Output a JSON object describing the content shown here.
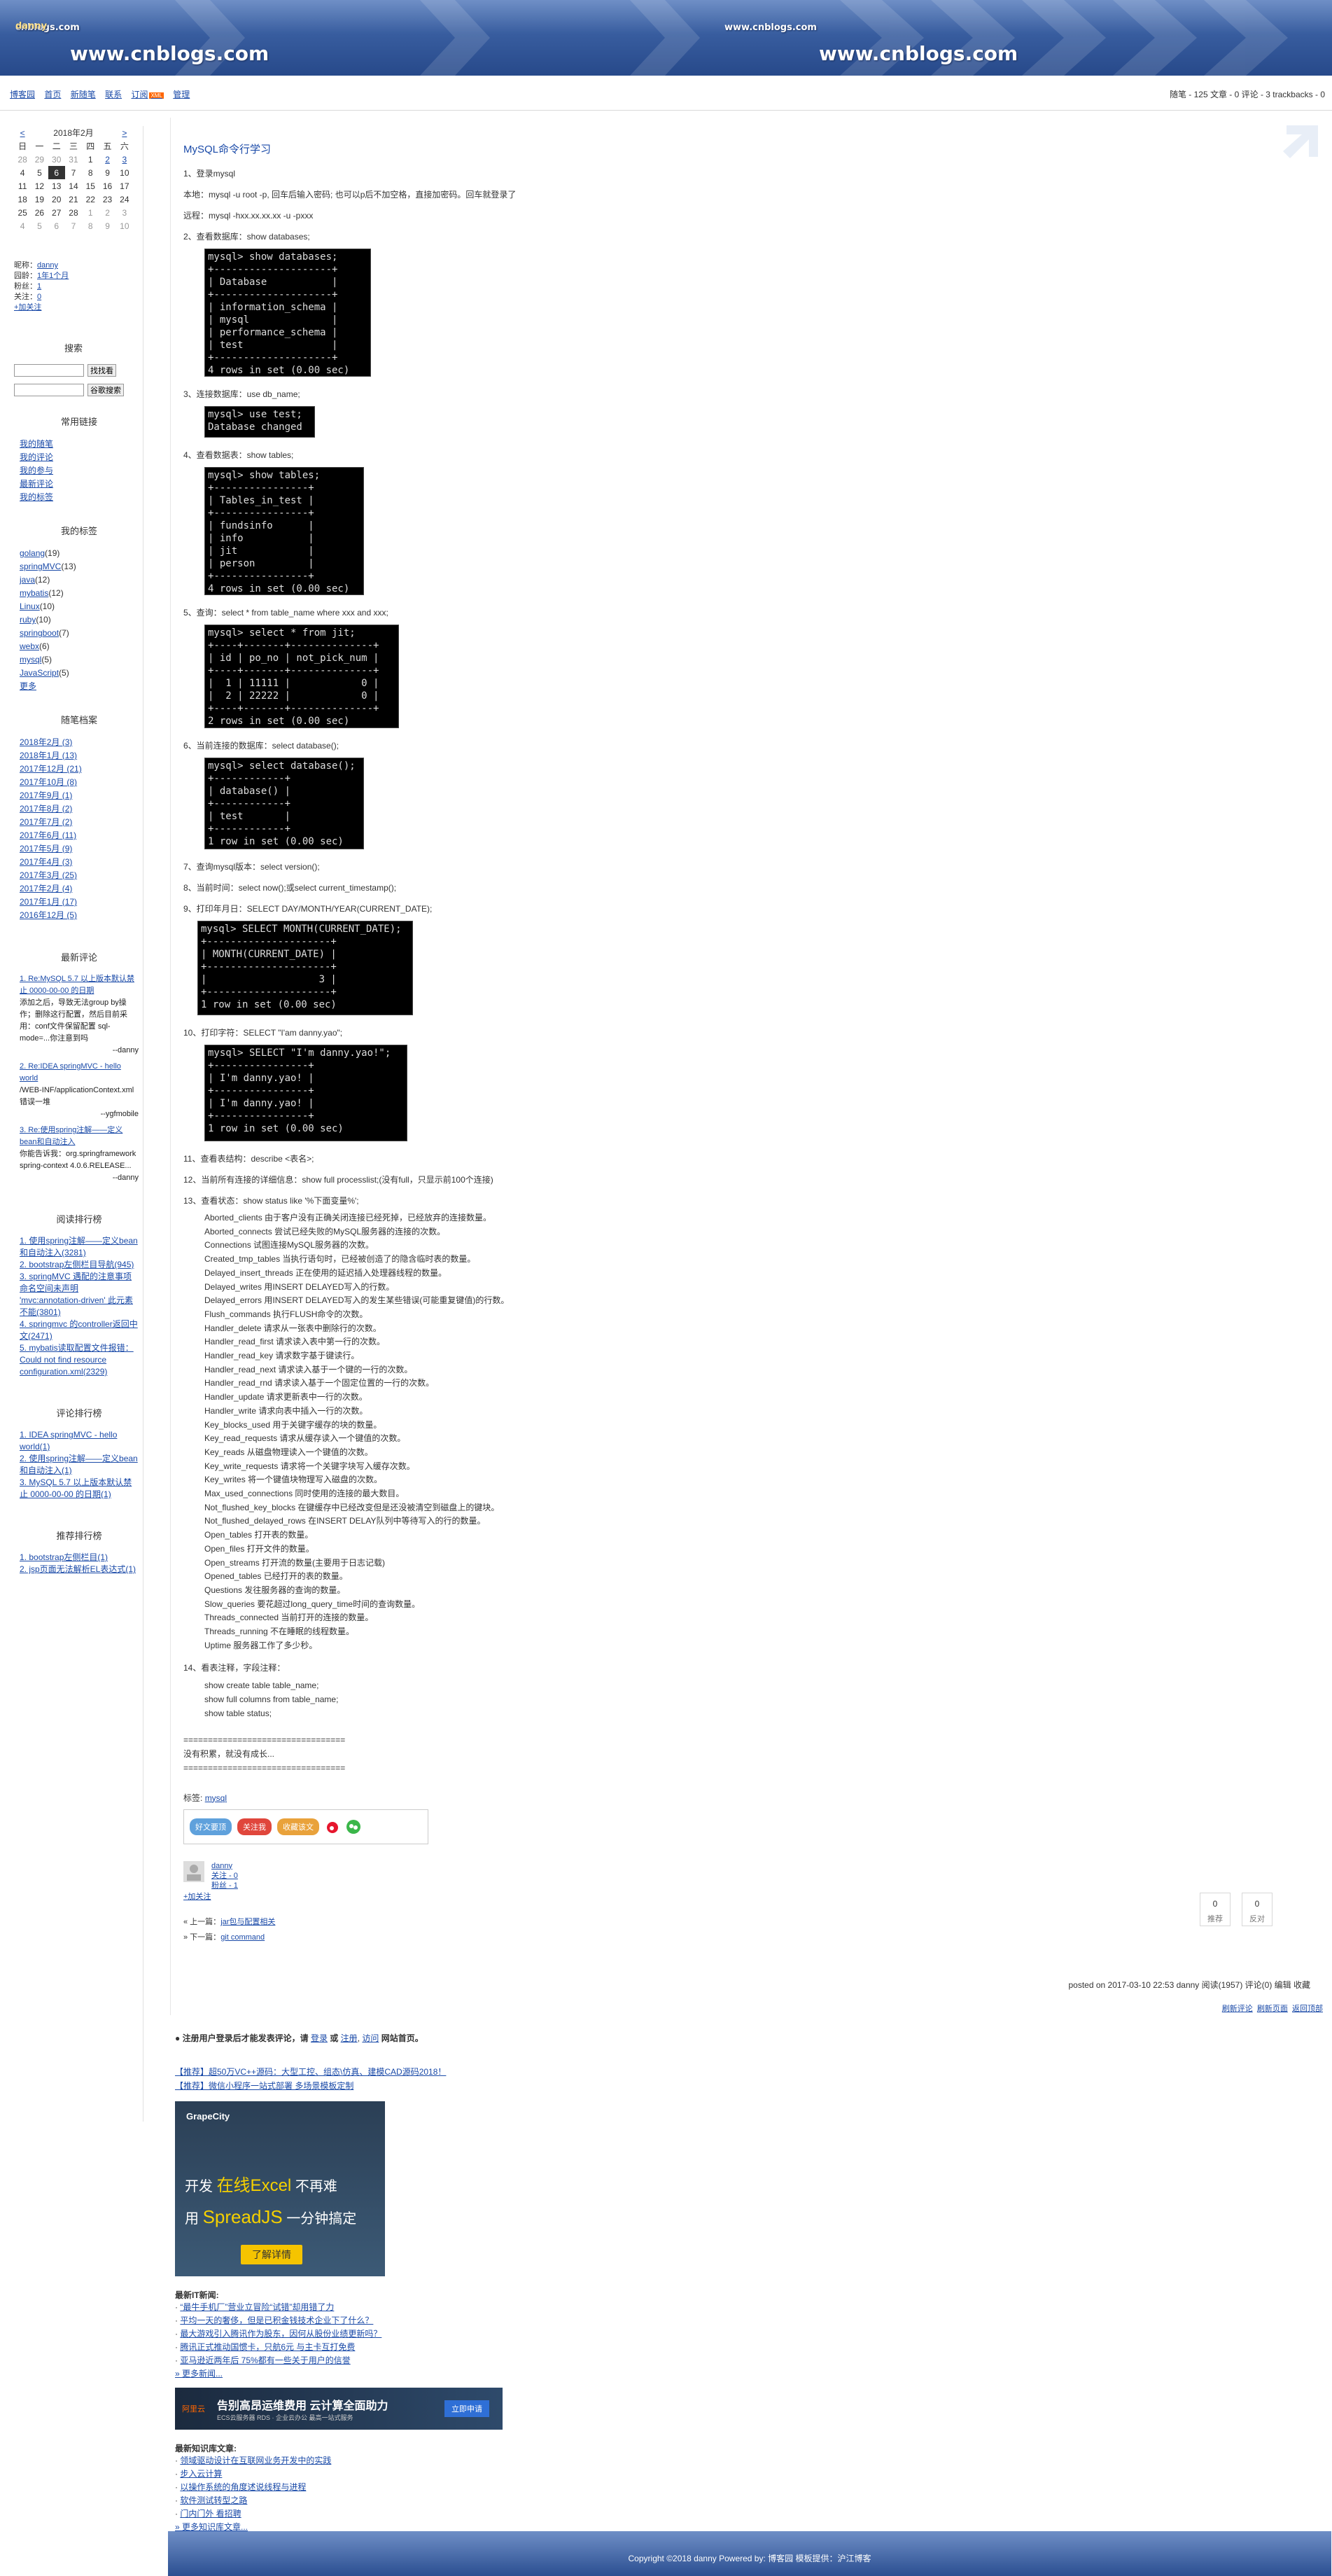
{
  "header": {
    "site_left_top": "cnblogs.com",
    "site_left_big": "www.cnblogs.com",
    "site_right_top": "www.cnblogs.com",
    "site_right_big": "www.cnblogs.com",
    "blog_name": "danny"
  },
  "nav": {
    "links": [
      "博客园",
      "首页",
      "新随笔",
      "联系",
      "订阅",
      "管理"
    ],
    "rss_badge": "XML",
    "stats": "随笔 - 125  文章 - 0  评论 - 3  trackbacks - 0"
  },
  "calendar": {
    "prev": "<",
    "title": "2018年2月",
    "next": ">",
    "weekdays": [
      "日",
      "一",
      "二",
      "三",
      "四",
      "五",
      "六"
    ],
    "rows": [
      [
        "28",
        "29",
        "30",
        "31",
        "1",
        "2",
        "3"
      ],
      [
        "4",
        "5",
        "6",
        "7",
        "8",
        "9",
        "10"
      ],
      [
        "11",
        "12",
        "13",
        "14",
        "15",
        "16",
        "17"
      ],
      [
        "18",
        "19",
        "20",
        "21",
        "22",
        "23",
        "24"
      ],
      [
        "25",
        "26",
        "27",
        "28",
        "1",
        "2",
        "3"
      ],
      [
        "4",
        "5",
        "6",
        "7",
        "8",
        "9",
        "10"
      ]
    ]
  },
  "profile": {
    "nick_label": "昵称：",
    "nick": "danny",
    "age_label": "园龄：",
    "age": "1年1个月",
    "fans_label": "粉丝：",
    "fans": "1",
    "follow_label": "关注：",
    "follow": "0",
    "add_follow": "+加关注"
  },
  "search": {
    "title": "搜索",
    "btn1": "找找看",
    "btn2": "谷歌搜索"
  },
  "links": {
    "title": "常用链接",
    "items": [
      "我的随笔",
      "我的评论",
      "我的参与",
      "最新评论",
      "我的标签"
    ]
  },
  "tags": {
    "title": "我的标签",
    "items": [
      {
        "n": "golang",
        "c": "(19)"
      },
      {
        "n": "springMVC",
        "c": "(13)"
      },
      {
        "n": "java",
        "c": "(12)"
      },
      {
        "n": "mybatis",
        "c": "(12)"
      },
      {
        "n": "Linux",
        "c": "(10)"
      },
      {
        "n": "ruby",
        "c": "(10)"
      },
      {
        "n": "springboot",
        "c": "(7)"
      },
      {
        "n": "webx",
        "c": "(6)"
      },
      {
        "n": "mysql",
        "c": "(5)"
      },
      {
        "n": "JavaScript",
        "c": "(5)"
      },
      {
        "n": "更多",
        "c": ""
      }
    ]
  },
  "archive": {
    "title": "随笔档案",
    "items": [
      "2018年2月 (3)",
      "2018年1月 (13)",
      "2017年12月 (21)",
      "2017年10月 (8)",
      "2017年9月 (1)",
      "2017年8月 (2)",
      "2017年7月 (2)",
      "2017年6月 (11)",
      "2017年5月 (9)",
      "2017年4月 (3)",
      "2017年3月 (25)",
      "2017年2月 (4)",
      "2017年1月 (17)",
      "2016年12月 (5)"
    ]
  },
  "recent_comments": {
    "title": "最新评论",
    "items": [
      {
        "link": "1. Re:MySQL 5.7 以上版本默认禁止 0000-00-00 的日期",
        "body": "添加之后，导致无法group by操作；删除这行配置，然后目前采用：conf文件保留配置 sql-mode=...你注意到吗",
        "author": "--danny"
      },
      {
        "link": "2. Re:IDEA springMVC - hello world",
        "body": "/WEB-INF/applicationContext.xml 错误一堆",
        "author": "--ygfmobile"
      },
      {
        "link": "3. Re:使用spring注解——定义bean和自动注入",
        "body": "你能告诉我：org.springframework spring-context 4.0.6.RELEASE...",
        "author": "--danny"
      }
    ]
  },
  "read_rank": {
    "title": "阅读排行榜",
    "items": [
      "1. 使用spring注解——定义bean和自动注入(3281)",
      "2. bootstrap左侧栏目导航(945)",
      "3. springMVC 遇配的注意事项 命名空间未声明 'mvc:annotation-driven' 此元素不能(3801)",
      "4. springmvc 的controller返回中文(2471)",
      "5. mybatis读取配置文件报错：Could not find resource configuration.xml(2329)"
    ]
  },
  "comment_rank": {
    "title": "评论排行榜",
    "items": [
      "1. IDEA springMVC - hello world(1)",
      "2. 使用spring注解——定义bean和自动注入(1)",
      "3. MySQL 5.7 以上版本默认禁止 0000-00-00 的日期(1)"
    ]
  },
  "recommend_rank": {
    "title": "推荐排行榜",
    "items": [
      "1. bootstrap左侧栏目(1)",
      "2. jsp页面无法解析EL表达式(1)"
    ]
  },
  "post": {
    "title": "MySQL命令行学习",
    "s1": "1、登录mysql",
    "s1a": "本地：mysql -u root -p, 回车后输入密码; 也可以p后不加空格，直接加密码。回车就登录了",
    "s1b": "远程：mysql -hxx.xx.xx.xx -u -pxxx",
    "s2": "2、查看数据库：show databases;",
    "t2": "mysql> show databases;\n+--------------------+\n| Database           |\n+--------------------+\n| information_schema |\n| mysql              |\n| performance_schema |\n| test               |\n+--------------------+\n4 rows in set (0.00 sec)",
    "s3": "3、连接数据库：use db_name;",
    "t3": "mysql> use test;\nDatabase changed",
    "s4": "4、查看数据表：show tables;",
    "t4": "mysql> show tables;\n+----------------+\n| Tables_in_test |\n+----------------+\n| fundsinfo      |\n| info           |\n| jit            |\n| person         |\n+----------------+\n4 rows in set (0.00 sec)",
    "s5": "5、查询：select * from table_name where xxx and xxx;",
    "t5": "mysql> select * from jit;\n+----+-------+--------------+\n| id | po_no | not_pick_num |\n+----+-------+--------------+\n|  1 | 11111 |            0 |\n|  2 | 22222 |            0 |\n+----+-------+--------------+\n2 rows in set (0.00 sec)",
    "s6": "6、当前连接的数据库：select database();",
    "t6": "mysql> select database();\n+------------+\n| database() |\n+------------+\n| test       |\n+------------+\n1 row in set (0.00 sec)",
    "s7": "7、查询mysql版本：select version();",
    "s8": "8、当前时间：select now();或select current_timestamp();",
    "s9": "9、打印年月日：SELECT DAY/MONTH/YEAR(CURRENT_DATE);",
    "t9": "mysql> SELECT MONTH(CURRENT_DATE);\n+---------------------+\n| MONTH(CURRENT_DATE) |\n+---------------------+\n|                   3 |\n+---------------------+\n1 row in set (0.00 sec)",
    "s10": "10、打印字符：SELECT \"I'am danny.yao\";",
    "t10": "mysql> SELECT \"I'm danny.yao!\";\n+----------------+\n| I'm danny.yao! |\n+----------------+\n| I'm danny.yao! |\n+----------------+\n1 row in set (0.00 sec)",
    "s11": "11、查看表结构：describe <表名>;",
    "s12": "12、当前所有连接的详细信息：show full processlist;(没有full，只显示前100个连接)",
    "s13": "13、查看状态：show status like '%下面变量%';",
    "status_vars": [
      "Aborted_clients 由于客户没有正确关闭连接已经死掉，已经放弃的连接数量。",
      "Aborted_connects 尝试已经失败的MySQL服务器的连接的次数。",
      "Connections 试图连接MySQL服务器的次数。",
      "Created_tmp_tables 当执行语句时，已经被创造了的隐含临时表的数量。",
      "Delayed_insert_threads 正在使用的延迟插入处理器线程的数量。",
      "Delayed_writes 用INSERT DELAYED写入的行数。",
      "Delayed_errors 用INSERT DELAYED写入的发生某些错误(可能重复键值)的行数。",
      "Flush_commands 执行FLUSH命令的次数。",
      "Handler_delete 请求从一张表中删除行的次数。",
      "Handler_read_first 请求读入表中第一行的次数。",
      "Handler_read_key 请求数字基于键读行。",
      "Handler_read_next 请求读入基于一个键的一行的次数。",
      "Handler_read_rnd 请求读入基于一个固定位置的一行的次数。",
      "Handler_update 请求更新表中一行的次数。",
      "Handler_write 请求向表中插入一行的次数。",
      "Key_blocks_used 用于关键字缓存的块的数量。",
      "Key_read_requests 请求从缓存读入一个键值的次数。",
      "Key_reads 从磁盘物理读入一个键值的次数。",
      "Key_write_requests 请求将一个关键字块写入缓存次数。",
      "Key_writes 将一个键值块物理写入磁盘的次数。",
      "Max_used_connections 同时使用的连接的最大数目。",
      "Not_flushed_key_blocks 在键缓存中已经改变但是还没被清空到磁盘上的键块。",
      "Not_flushed_delayed_rows 在INSERT DELAY队列中等待写入的行的数量。",
      "Open_tables 打开表的数量。",
      "Open_files 打开文件的数量。",
      "Open_streams 打开流的数量(主要用于日志记载)",
      "Opened_tables 已经打开的表的数量。",
      "Questions 发往服务器的查询的数量。",
      "Slow_queries 要花超过long_query_time时间的查询数量。",
      "Threads_connected 当前打开的连接的数量。",
      "Threads_running 不在睡眠的线程数量。",
      "Uptime 服务器工作了多少秒。"
    ],
    "s14": "14、看表注释，字段注释：",
    "stmts": [
      "show create table table_name;",
      "show full columns from table_name;",
      "show table status;"
    ],
    "sep1": "=================================",
    "sep_text": "没有积累，就没有成长...",
    "sep2": "=================================",
    "tag_label": "标签:",
    "tag": "mysql",
    "share": [
      "好文要顶",
      "关注我",
      "收藏该文"
    ],
    "author": "danny",
    "author_follow": "关注 - 0",
    "author_fans": "粉丝 - 1",
    "add_follow": "+加关注",
    "up_count": "0",
    "up_label": "推荐",
    "down_count": "0",
    "down_label": "反对",
    "prev_label": "« 上一篇：",
    "prev": "jar包与配置相关",
    "next_label": "» 下一篇：",
    "next": "git command",
    "footer_info": "posted on 2017-03-10 22:53 danny 阅读(1957) 评论(0) 编辑 收藏"
  },
  "comments_bar": {
    "links": [
      "刷新评论",
      "刷新页面",
      "返回顶部"
    ]
  },
  "comment_notice": {
    "text": "注册用户登录后才能发表评论，请",
    "login": "登录",
    "or": "或",
    "register": "注册",
    "visit": "访问",
    "tail": "网站首页。"
  },
  "promo": {
    "ad1": "【推荐】超50万VC++源码：大型工控、组态\\仿真、建模CAD源码2018！",
    "ad2": "【推荐】微信小程序一站式部署 多场景模板定制"
  },
  "banner": {
    "brand": "GrapeCity",
    "line1a": "开发",
    "line1b": "在线Excel",
    "line1c": "不再难",
    "line2a": "用",
    "line2b": "SpreadJS",
    "line2c": "一分钟搞定",
    "cta": "了解详情"
  },
  "it_news": {
    "title": "最新IT新闻:",
    "items": [
      "“最牛手机厂”营业立冒险“试错”却用错了力",
      "平均一天的奢侈，但是已积金钱技术企业下了什么？",
      "最大游戏引入腾讯作为股东，因何从股份业绩更新吗？",
      "腾讯正式推动国惯卡，只航6元 与主卡互打免费",
      "亚马逊近两年后 75%都有一些关于用户的信誉"
    ],
    "more": "» 更多新闻..."
  },
  "ad_cloud": {
    "brand": "阿里云",
    "main": "告别高昂运维费用 云计算全面助力",
    "sub": "ECS云服务器 RDS · 企业云办公 最高一站式服务",
    "btn": "立即申请"
  },
  "knowledge": {
    "title": "最新知识库文章:",
    "items": [
      "领域驱动设计在互联网业务开发中的实践",
      "步入云计算",
      "以操作系统的角度述说线程与进程",
      "软件测试转型之路",
      "门内门外 看招聘"
    ],
    "more": "» 更多知识库文章..."
  },
  "footer": {
    "text": "Copyright ©2018 danny Powered by: 博客园 模板提供：沪江博客"
  }
}
